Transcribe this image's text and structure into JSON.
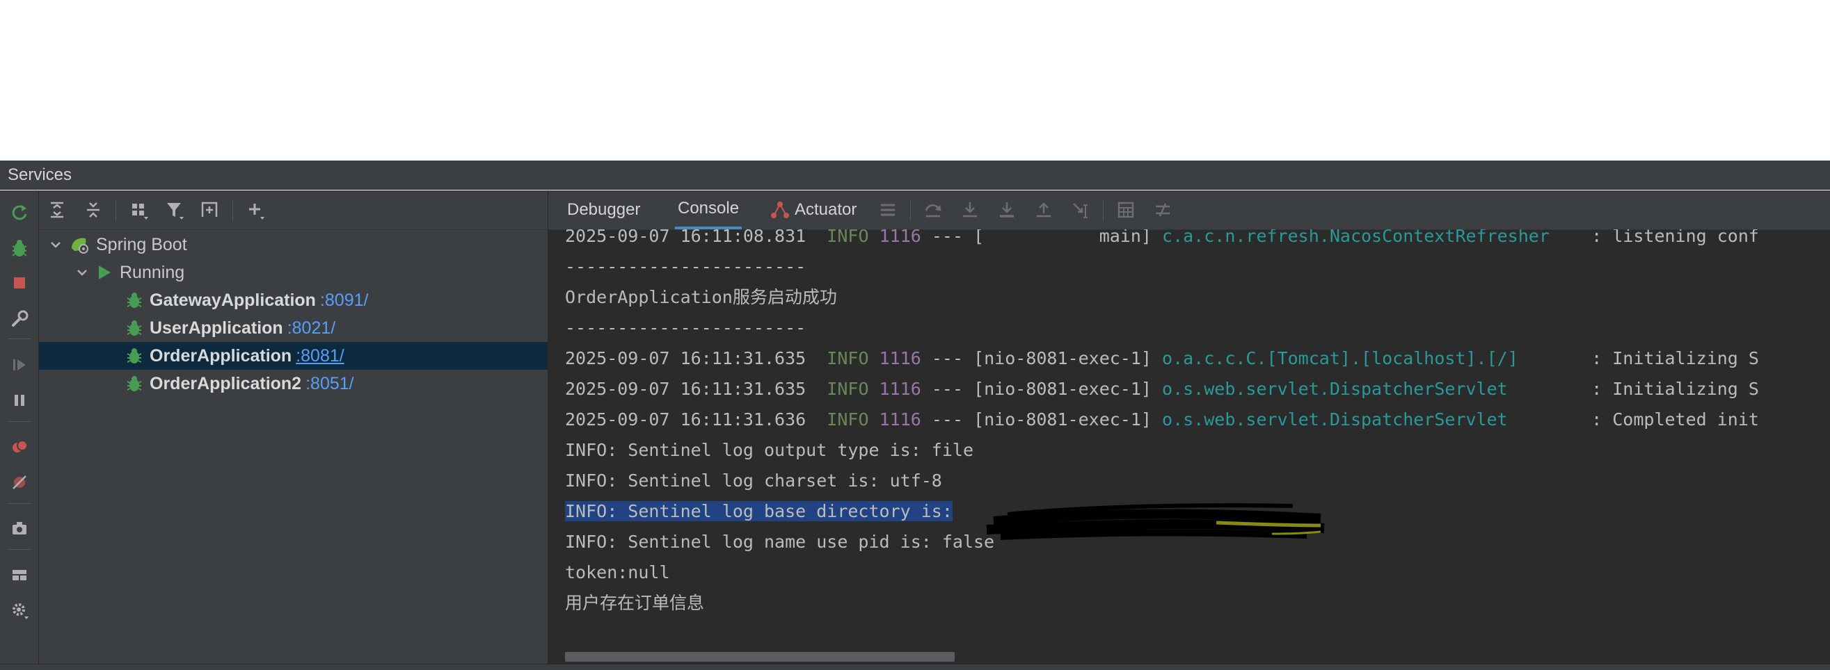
{
  "services": {
    "title": "Services"
  },
  "tree": {
    "root": {
      "label": "Spring Boot"
    },
    "group": {
      "label": "Running"
    },
    "apps": [
      {
        "name": "GatewayApplication",
        "port": ":8091/"
      },
      {
        "name": "UserApplication",
        "port": ":8021/"
      },
      {
        "name": "OrderApplication",
        "port": ":8081/"
      },
      {
        "name": "OrderApplication2",
        "port": ":8051/"
      }
    ]
  },
  "tabs": {
    "debugger": "Debugger",
    "console": "Console",
    "actuator": "Actuator"
  },
  "console": {
    "lines": [
      {
        "ts": "2025-09-07 16:11:08.831",
        "level": "INFO",
        "pid": "1116",
        "sep": "---",
        "thread": "[           main]",
        "logger": "c.a.c.n.refresh.NacosContextRefresher",
        "msg": ": listening conf"
      },
      {
        "text": "-----------------------"
      },
      {
        "text": "OrderApplication服务启动成功"
      },
      {
        "text": "-----------------------"
      },
      {
        "ts": "2025-09-07 16:11:31.635",
        "level": "INFO",
        "pid": "1116",
        "sep": "---",
        "thread": "[nio-8081-exec-1]",
        "logger": "o.a.c.c.C.[Tomcat].[localhost].[/]",
        "msg": ": Initializing S"
      },
      {
        "ts": "2025-09-07 16:11:31.635",
        "level": "INFO",
        "pid": "1116",
        "sep": "---",
        "thread": "[nio-8081-exec-1]",
        "logger": "o.s.web.servlet.DispatcherServlet",
        "msg": ": Initializing S"
      },
      {
        "ts": "2025-09-07 16:11:31.636",
        "level": "INFO",
        "pid": "1116",
        "sep": "---",
        "thread": "[nio-8081-exec-1]",
        "logger": "o.s.web.servlet.DispatcherServlet",
        "msg": ": Completed init"
      },
      {
        "text": "INFO: Sentinel log output type is: file"
      },
      {
        "text": "INFO: Sentinel log charset is: utf-8"
      },
      {
        "text": "INFO: Sentinel log base directory is:"
      },
      {
        "text": "INFO: Sentinel log name use pid is: false"
      },
      {
        "text": "token:null"
      },
      {
        "text": "用户存在订单信息"
      }
    ]
  },
  "colors": {
    "panel_bg": "#3c3f41",
    "console_bg": "#2b2b2b",
    "selection": "#0d293e",
    "text_selection": "#214283",
    "info": "#6a8759",
    "pid": "#9876aa",
    "logger": "#299999",
    "link": "#589df6",
    "run_green": "#499c54",
    "stop_red": "#c75450"
  },
  "icons": {
    "left_strip": [
      "rerun-icon",
      "debug-icon",
      "stop-icon",
      "wrench-icon",
      "resume-icon",
      "pause-icon",
      "breakpoints-icon",
      "mute-breakpoints-icon",
      "camera-icon",
      "layout-icon",
      "settings-icon"
    ],
    "tree_toolbar": [
      "expand-all-icon",
      "collapse-all-icon",
      "group-icon",
      "filter-icon",
      "new-tab-icon",
      "add-icon"
    ],
    "console_toolbar": [
      "menu-icon",
      "step-over-icon",
      "step-into-icon",
      "force-step-into-icon",
      "step-out-icon",
      "run-to-cursor-icon",
      "evaluate-icon",
      "trace-icon"
    ]
  }
}
